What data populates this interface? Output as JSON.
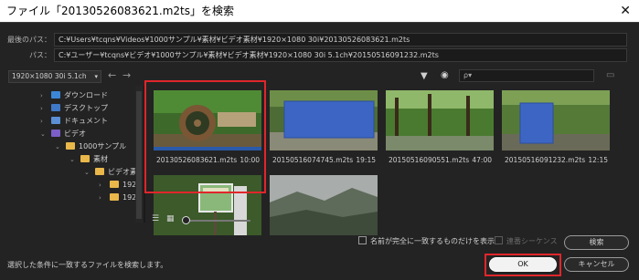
{
  "window": {
    "title": "ファイル「20130526083621.m2ts」を検索",
    "close_glyph": "✕"
  },
  "paths": {
    "last_label": "最後のパス：",
    "last_value": "C:¥Users¥tcqns¥Videos¥1000サンプル¥素材¥ビデオ素材¥1920×1080 30i¥20130526083621.m2ts",
    "path_label": "パス：",
    "path_value": "C:¥ユーザー¥tcqns¥ビデオ¥1000サンプル¥素材¥ビデオ素材¥1920×1080 30i 5.1ch¥20150516091232.m2ts"
  },
  "toolbar": {
    "dropdown_value": "1920×1080 30i 5.1ch",
    "dropdown_arrow": "▾",
    "back_glyph": "←",
    "forward_glyph": "→",
    "filter_glyph": "▼",
    "eye_glyph": "◉",
    "search_placeholder": "ρ▾"
  },
  "tree": [
    {
      "label": "ダウンロード",
      "icon": "download-folder-icon",
      "type": "dl"
    },
    {
      "label": "デスクトップ",
      "icon": "desktop-folder-icon",
      "type": "desk"
    },
    {
      "label": "ドキュメント",
      "icon": "documents-folder-icon",
      "type": "doc"
    },
    {
      "label": "ビデオ",
      "icon": "videos-folder-icon",
      "type": "vid"
    },
    {
      "label": "1000サンプル",
      "icon": "folder-icon",
      "type": ""
    },
    {
      "label": "素材",
      "icon": "folder-icon",
      "type": ""
    },
    {
      "label": "ビデオ素",
      "icon": "folder-icon",
      "type": ""
    },
    {
      "label": "192",
      "icon": "folder-icon",
      "type": ""
    },
    {
      "label": "192",
      "icon": "folder-icon",
      "type": ""
    }
  ],
  "files": [
    {
      "name": "20130526083621.m2ts",
      "duration": "10:00",
      "thumb": "waterwheel",
      "selected": true
    },
    {
      "name": "20150516074745.m2ts",
      "duration": "19:15",
      "thumb": "blue-wide"
    },
    {
      "name": "20150516090551.m2ts",
      "duration": "47:00",
      "thumb": "forest"
    },
    {
      "name": "20150516091232.m2ts",
      "duration": "12:15",
      "thumb": "blue-center"
    },
    {
      "name": "",
      "duration": "",
      "thumb": "sign"
    },
    {
      "name": "",
      "duration": "",
      "thumb": "fog"
    }
  ],
  "options": {
    "exact_match_label": "名前が完全に一致するものだけを表示",
    "sequence_label": "連番シーケンス"
  },
  "buttons": {
    "search": "検索",
    "ok": "OK",
    "cancel": "キャンセル"
  },
  "status": "選択した条件に一致するファイルを検索します。",
  "colors": {
    "dialog_bg": "#232323",
    "highlight": "#e0262b",
    "placeholder_blue": "#3d66c4"
  }
}
